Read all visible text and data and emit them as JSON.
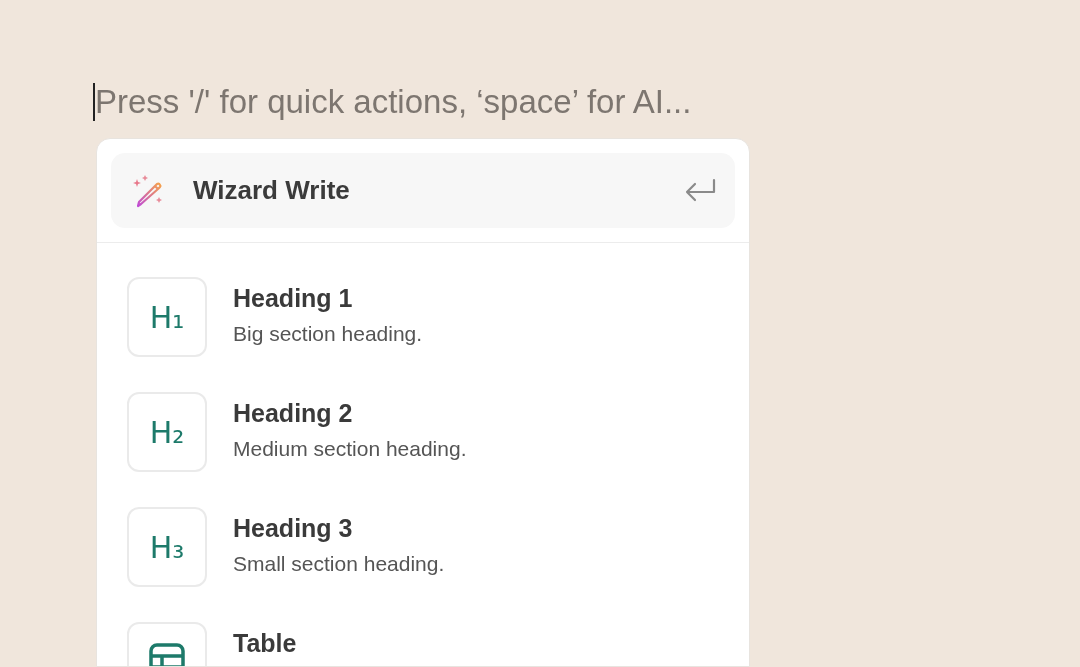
{
  "editor": {
    "placeholder": "Press '/' for quick actions, ‘space’ for AI..."
  },
  "menu": {
    "ai_action": {
      "label": "Wizard Write",
      "selected": true
    },
    "items": [
      {
        "kind": "heading",
        "icon_text": "H₁",
        "title": "Heading 1",
        "description": "Big section heading.",
        "selected": false
      },
      {
        "kind": "heading",
        "icon_text": "H₂",
        "title": "Heading 2",
        "description": "Medium section heading.",
        "selected": false
      },
      {
        "kind": "heading",
        "icon_text": "H₃",
        "title": "Heading 3",
        "description": "Small section heading.",
        "selected": false
      },
      {
        "kind": "table",
        "title": "Table",
        "selected": false
      }
    ]
  }
}
